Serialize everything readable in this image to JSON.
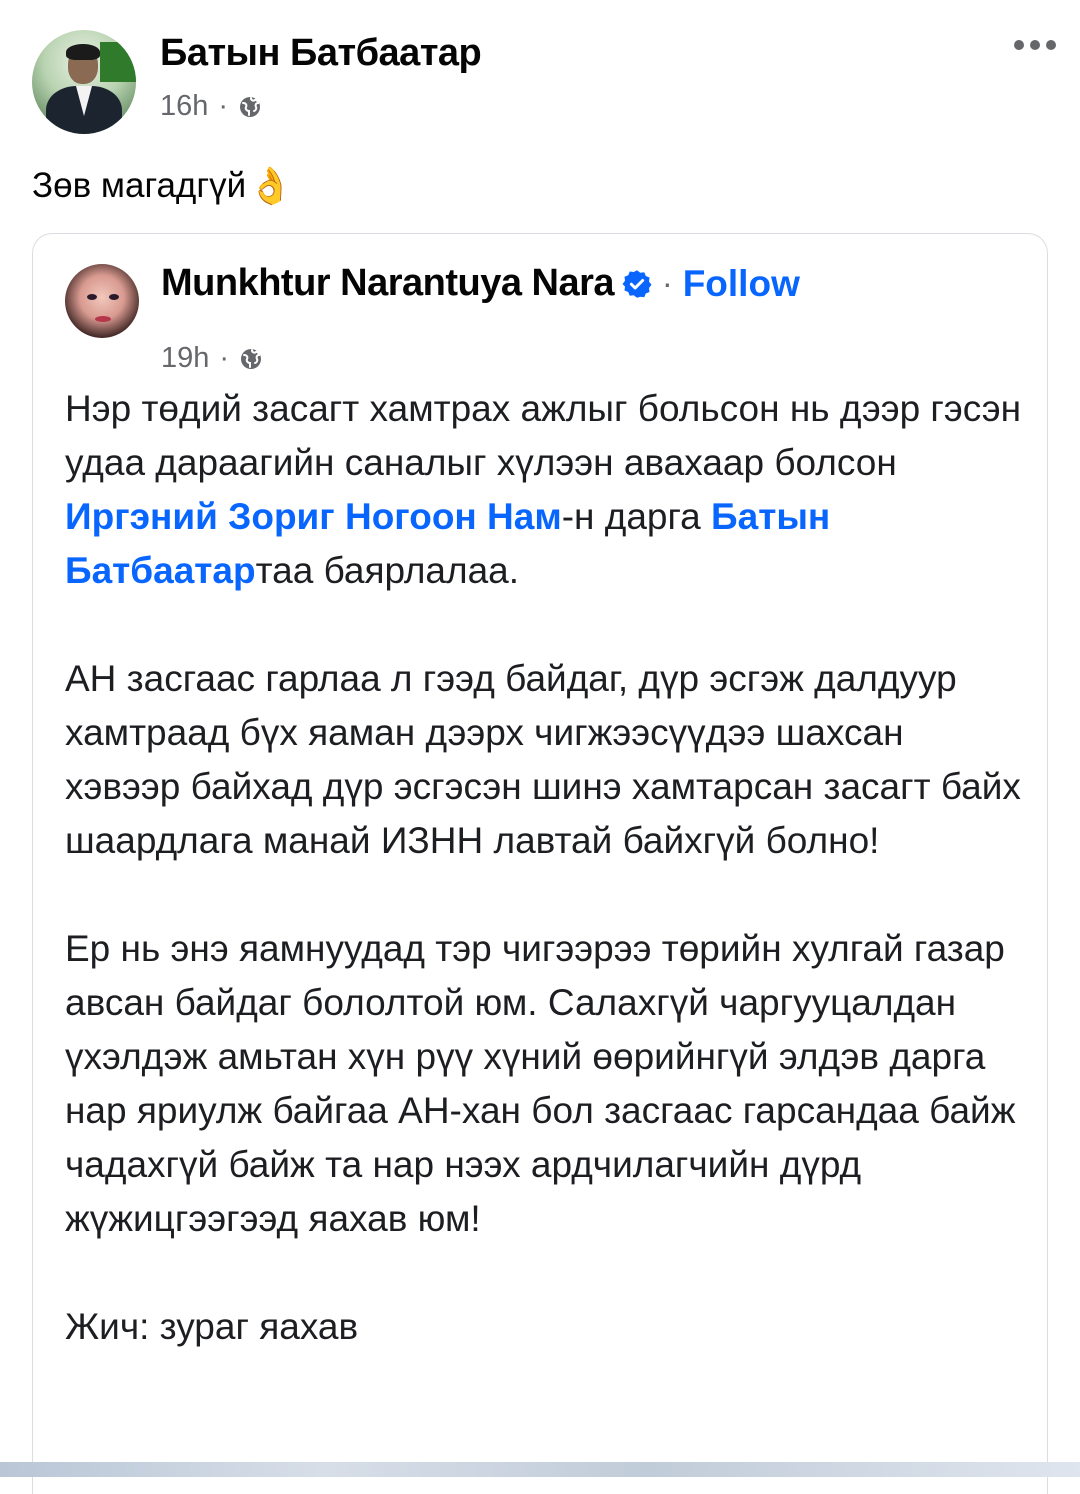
{
  "post": {
    "author": "Батын Батбаатар",
    "time": "16h",
    "separator": "·",
    "text": "Зөв магадгүй",
    "emoji": "👌",
    "more_icon": "ellipsis-icon",
    "audience_icon": "globe-icon"
  },
  "shared_post": {
    "author": "Munkhtur Narantuya Nara",
    "verified_icon": "verified-badge-icon",
    "separator": "·",
    "follow_label": "Follow",
    "time": "19h",
    "para1": {
      "text_a": "Нэр төдий засагт хамтрах ажлыг больсон нь дээр гэсэн удаа дараагийн саналыг хүлээн авахаар болсон ",
      "link_a": "Иргэний Зориг Ногоон Нам",
      "text_b": "-н дарга ",
      "link_b": "Батын Батбаатар",
      "text_c": "таа баярлалаа."
    },
    "para2": "АН засгаас гарлаа л гээд байдаг, дүр эсгэж далдуур хамтраад бүх яаман дээрх чигжээсүүдээ шахсан хэвээр байхад дүр эсгэсэн шинэ хамтарсан засагт байх шаардлага манай ИЗНН лавтай байхгүй болно!",
    "para3": "Ер нь энэ яамнуудад тэр чигээрээ төрийн хулгай газар авсан байдаг бололтой юм. Салахгүй чаргууцалдан үхэлдэж амьтан хүн рүү хүний өөрийнгүй элдэв дарга нар яриулж байгаа АН-хан бол засгаас гарсандаа байж чадахгүй байж та нар нээх ардчилагчийн дүрд жүжицгээгээд яахав юм!",
    "ps": "Жич: зураг яахав"
  },
  "colors": {
    "link": "#0866ff",
    "meta": "#65676b",
    "text": "#1c1e21"
  }
}
